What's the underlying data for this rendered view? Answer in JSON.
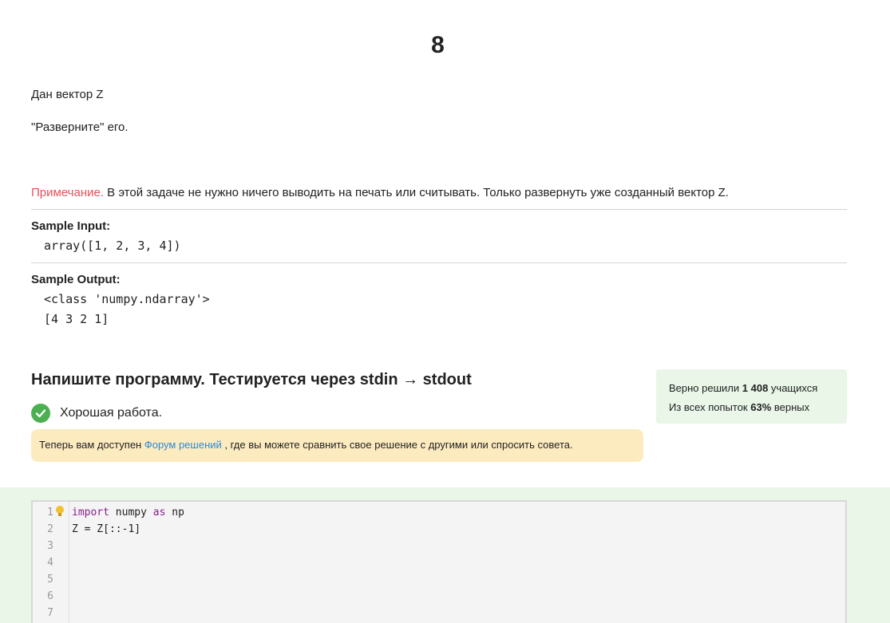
{
  "step": {
    "title": "8"
  },
  "statement": {
    "line1": "Дан вектор Z",
    "line2": "\"Разверните\" его.",
    "note_label": "Примечание.",
    "note_text": " В этой задаче не нужно ничего выводить на печать или считывать. Только развернуть уже созданный вектор Z."
  },
  "samples": {
    "input_label": "Sample Input:",
    "input_lines": [
      "array([1, 2, 3, 4])"
    ],
    "output_label": "Sample Output:",
    "output_lines": [
      "<class 'numpy.ndarray'>",
      "[4 3 2 1]"
    ]
  },
  "task": {
    "heading": "Напишите программу. Тестируется через stdin → stdout",
    "success_text": "Хорошая работа.",
    "forum_prefix": "Теперь вам доступен ",
    "forum_link": "Форум решений",
    "forum_suffix": " , где вы можете сравнить свое решение с другими или спросить совета."
  },
  "stats": {
    "line1_prefix": "Верно решили ",
    "solved_count": "1 408",
    "line1_suffix": " учащихся",
    "line2_prefix": "Из всех попыток ",
    "percent": "63%",
    "line2_suffix": " верных"
  },
  "editor": {
    "line_numbers": [
      "1",
      "2",
      "3",
      "4",
      "5",
      "6",
      "7"
    ],
    "code": {
      "l1_kw1": "import",
      "l1_mid": " numpy ",
      "l1_kw2": "as",
      "l1_end": " np",
      "l2": "Z = Z[::-1]"
    }
  },
  "colors": {
    "note": "#e8505b",
    "link": "#2a8ad8",
    "success": "#4caf50",
    "forum_bg": "#fdebc0",
    "stats_bg": "#e9f6e8",
    "keyword": "#8b1f8f"
  },
  "icons": [
    "check-icon",
    "bulb-icon"
  ]
}
